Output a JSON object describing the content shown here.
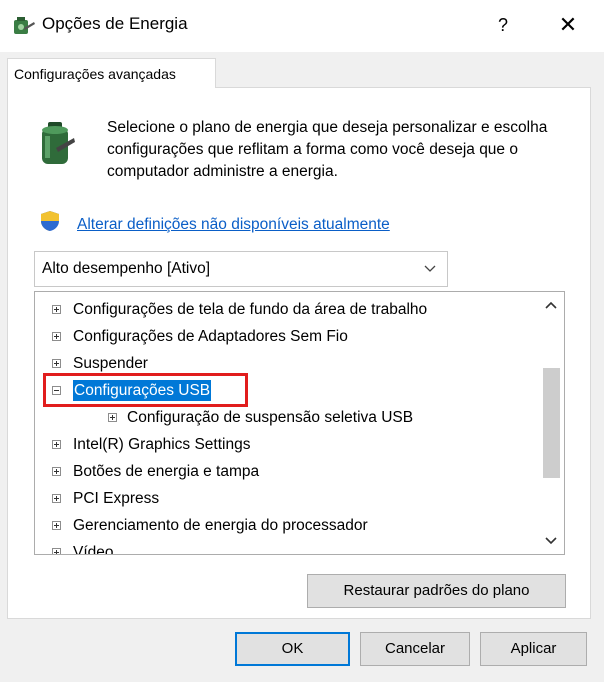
{
  "window": {
    "title": "Opções de Energia",
    "help_label": "?",
    "close_label": "✕"
  },
  "tabs": [
    {
      "label": "Configurações avançadas",
      "active": true
    }
  ],
  "description": "Selecione o plano de energia que deseja personalizar e escolha configurações que reflitam a forma como você deseja que o computador administre a energia.",
  "change_link": "Alterar definições não disponíveis atualmente",
  "plan_select": {
    "value": "Alto desempenho [Ativo]"
  },
  "tree": {
    "items": [
      {
        "label": "Configurações de tela de fundo da área de trabalho",
        "level": 0,
        "expanded": false,
        "selected": false
      },
      {
        "label": "Configurações de Adaptadores Sem Fio",
        "level": 0,
        "expanded": false,
        "selected": false
      },
      {
        "label": "Suspender",
        "level": 0,
        "expanded": false,
        "selected": false
      },
      {
        "label": "Configurações USB",
        "level": 0,
        "expanded": true,
        "selected": true
      },
      {
        "label": "Configuração de suspensão seletiva USB",
        "level": 1,
        "expanded": false,
        "selected": false
      },
      {
        "label": "Intel(R) Graphics Settings",
        "level": 0,
        "expanded": false,
        "selected": false
      },
      {
        "label": "Botões de energia e tampa",
        "level": 0,
        "expanded": false,
        "selected": false
      },
      {
        "label": "PCI Express",
        "level": 0,
        "expanded": false,
        "selected": false
      },
      {
        "label": "Gerenciamento de energia do processador",
        "level": 0,
        "expanded": false,
        "selected": false
      },
      {
        "label": "Vídeo",
        "level": 0,
        "expanded": false,
        "selected": false
      }
    ]
  },
  "buttons": {
    "restore": "Restaurar padrões do plano",
    "ok": "OK",
    "cancel": "Cancelar",
    "apply": "Aplicar"
  },
  "colors": {
    "accent": "#0078d7",
    "highlight_box": "#e11d1d",
    "link": "#0a5ec7"
  }
}
